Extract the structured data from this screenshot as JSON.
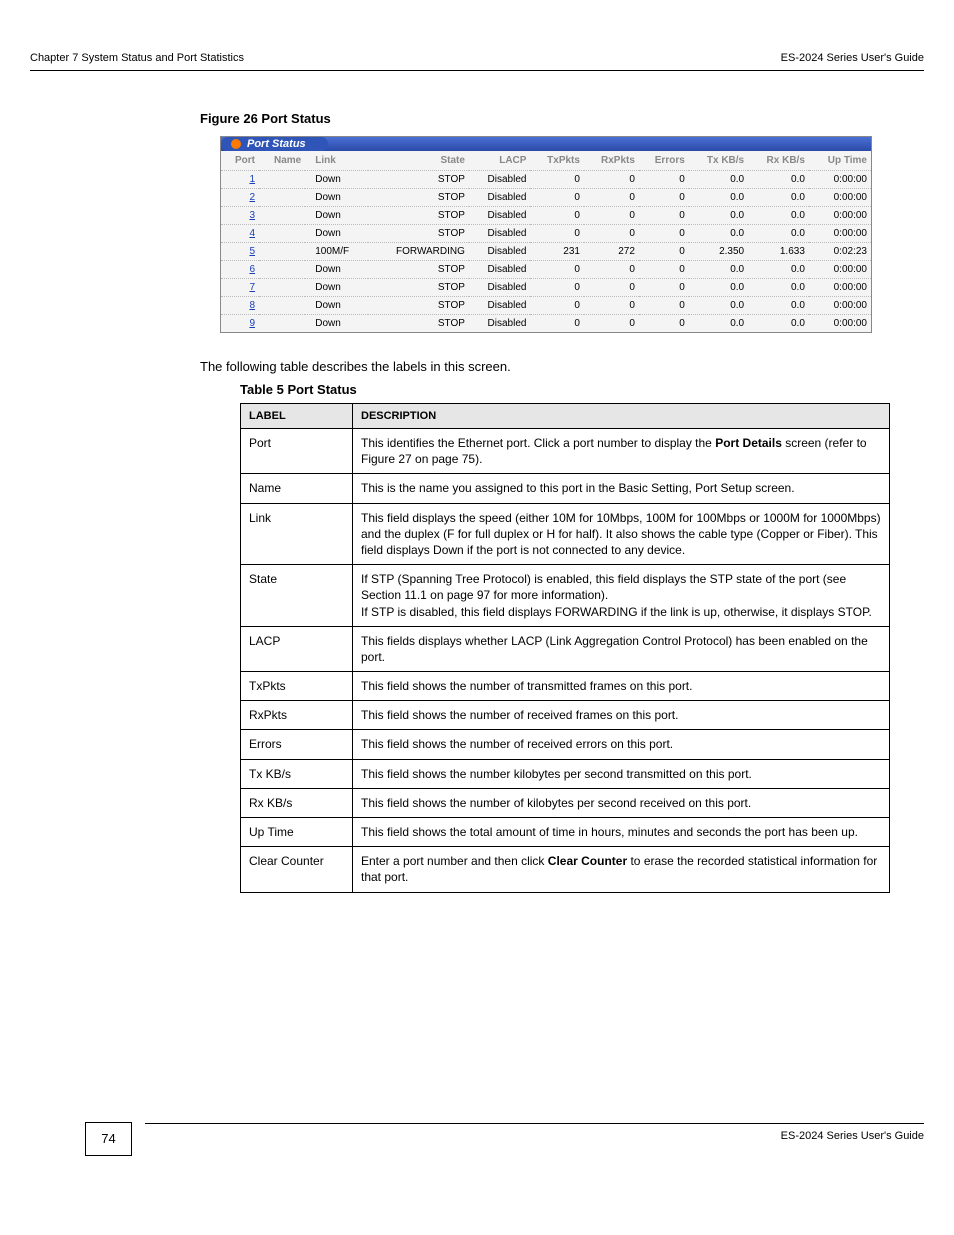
{
  "header": {
    "left": "Chapter 7 System Status and Port Statistics",
    "right": "ES-2024 Series User's Guide"
  },
  "figure_caption": "Figure 26   Port Status",
  "port_status": {
    "title": "Port Status",
    "columns": [
      "Port",
      "Name",
      "Link",
      "State",
      "LACP",
      "TxPkts",
      "RxPkts",
      "Errors",
      "Tx KB/s",
      "Rx KB/s",
      "Up Time"
    ],
    "rows": [
      {
        "port": "1",
        "name": "",
        "link": "Down",
        "state": "STOP",
        "lacp": "Disabled",
        "tx": "0",
        "rx": "0",
        "err": "0",
        "txkb": "0.0",
        "rxkb": "0.0",
        "up": "0:00:00"
      },
      {
        "port": "2",
        "name": "",
        "link": "Down",
        "state": "STOP",
        "lacp": "Disabled",
        "tx": "0",
        "rx": "0",
        "err": "0",
        "txkb": "0.0",
        "rxkb": "0.0",
        "up": "0:00:00"
      },
      {
        "port": "3",
        "name": "",
        "link": "Down",
        "state": "STOP",
        "lacp": "Disabled",
        "tx": "0",
        "rx": "0",
        "err": "0",
        "txkb": "0.0",
        "rxkb": "0.0",
        "up": "0:00:00"
      },
      {
        "port": "4",
        "name": "",
        "link": "Down",
        "state": "STOP",
        "lacp": "Disabled",
        "tx": "0",
        "rx": "0",
        "err": "0",
        "txkb": "0.0",
        "rxkb": "0.0",
        "up": "0:00:00"
      },
      {
        "port": "5",
        "name": "",
        "link": "100M/F",
        "state": "FORWARDING",
        "lacp": "Disabled",
        "tx": "231",
        "rx": "272",
        "err": "0",
        "txkb": "2.350",
        "rxkb": "1.633",
        "up": "0:02:23"
      },
      {
        "port": "6",
        "name": "",
        "link": "Down",
        "state": "STOP",
        "lacp": "Disabled",
        "tx": "0",
        "rx": "0",
        "err": "0",
        "txkb": "0.0",
        "rxkb": "0.0",
        "up": "0:00:00"
      },
      {
        "port": "7",
        "name": "",
        "link": "Down",
        "state": "STOP",
        "lacp": "Disabled",
        "tx": "0",
        "rx": "0",
        "err": "0",
        "txkb": "0.0",
        "rxkb": "0.0",
        "up": "0:00:00"
      },
      {
        "port": "8",
        "name": "",
        "link": "Down",
        "state": "STOP",
        "lacp": "Disabled",
        "tx": "0",
        "rx": "0",
        "err": "0",
        "txkb": "0.0",
        "rxkb": "0.0",
        "up": "0:00:00"
      },
      {
        "port": "9",
        "name": "",
        "link": "Down",
        "state": "STOP",
        "lacp": "Disabled",
        "tx": "0",
        "rx": "0",
        "err": "0",
        "txkb": "0.0",
        "rxkb": "0.0",
        "up": "0:00:00"
      }
    ]
  },
  "intro": "The following table describes the labels in this screen.",
  "table_caption": "Table 5   Port Status",
  "desc": {
    "head_label": "LABEL",
    "head_desc": "DESCRIPTION",
    "rows": [
      {
        "label": "Port",
        "pre": "This identifies the Ethernet port. Click a port number to display the ",
        "linktext": "Port Details",
        "post": " screen (refer to ",
        "figref": "Figure 27 on page 75",
        "post2": ")."
      },
      {
        "label": "Name",
        "text": "This is the name you assigned to this port in the Basic Setting, Port Setup screen."
      },
      {
        "label": "Link",
        "text": "This field displays the speed (either 10M for 10Mbps, 100M for 100Mbps or 1000M for 1000Mbps) and the duplex (F for full duplex or H for half). It also shows the cable type (Copper or Fiber). This field displays Down if the port is not connected to any device."
      },
      {
        "label": "State",
        "pre": "If STP (Spanning Tree Protocol) is enabled, this field displays the STP state of the port (see ",
        "secref": "Section 11.1 on page 97",
        "post": " for more information).",
        "line2": "If STP is disabled, this field displays FORWARDING if the link is up, otherwise, it displays STOP."
      },
      {
        "label": "LACP",
        "text": "This fields displays whether LACP (Link Aggregation Control Protocol) has been enabled on the port."
      },
      {
        "label": "TxPkts",
        "text": "This field shows the number of transmitted frames on this port."
      },
      {
        "label": "RxPkts",
        "text": "This field shows the number of received frames on this port."
      },
      {
        "label": "Errors",
        "text": "This field shows the number of received errors on this port."
      },
      {
        "label": "Tx KB/s",
        "text": "This field shows the number kilobytes per second transmitted on this port."
      },
      {
        "label": "Rx KB/s",
        "text": "This field shows the number of kilobytes per second received on this port."
      },
      {
        "label": "Up Time",
        "text": "This field shows the total amount of time in hours, minutes and seconds the port has been up."
      },
      {
        "label": "Clear Counter",
        "pre": "Enter a port number and then click ",
        "bold": "Clear Counter",
        "post": " to erase the recorded statistical information for that port."
      }
    ]
  },
  "footer": {
    "page": "74",
    "text": "ES-2024 Series User's Guide"
  }
}
